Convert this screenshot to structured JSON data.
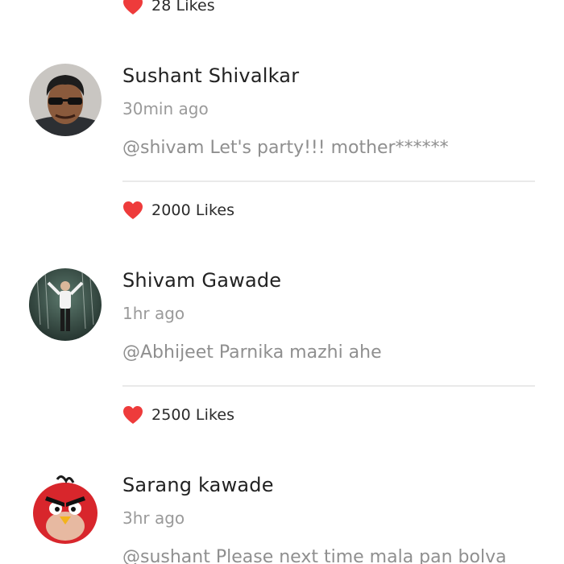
{
  "accent_color": "#ee3b3b",
  "top_likes": {
    "label": "28 Likes",
    "icon": "heart-icon"
  },
  "comments": [
    {
      "avatar": "user-photo-sunglasses",
      "name": "Sushant Shivalkar",
      "time": "30min ago",
      "text": "@shivam Let's party!!! mother******",
      "likes_label": "2000 Likes",
      "likes_icon": "heart-icon"
    },
    {
      "avatar": "user-photo-dancing-man",
      "name": "Shivam Gawade",
      "time": "1hr ago",
      "text": "@Abhijeet Parnika mazhi ahe",
      "likes_label": "2500 Likes",
      "likes_icon": "heart-icon"
    },
    {
      "avatar": "angry-bird-avatar",
      "name": "Sarang kawade",
      "time": "3hr ago",
      "text": "@sushant Please next time mala pan bolva"
    }
  ]
}
